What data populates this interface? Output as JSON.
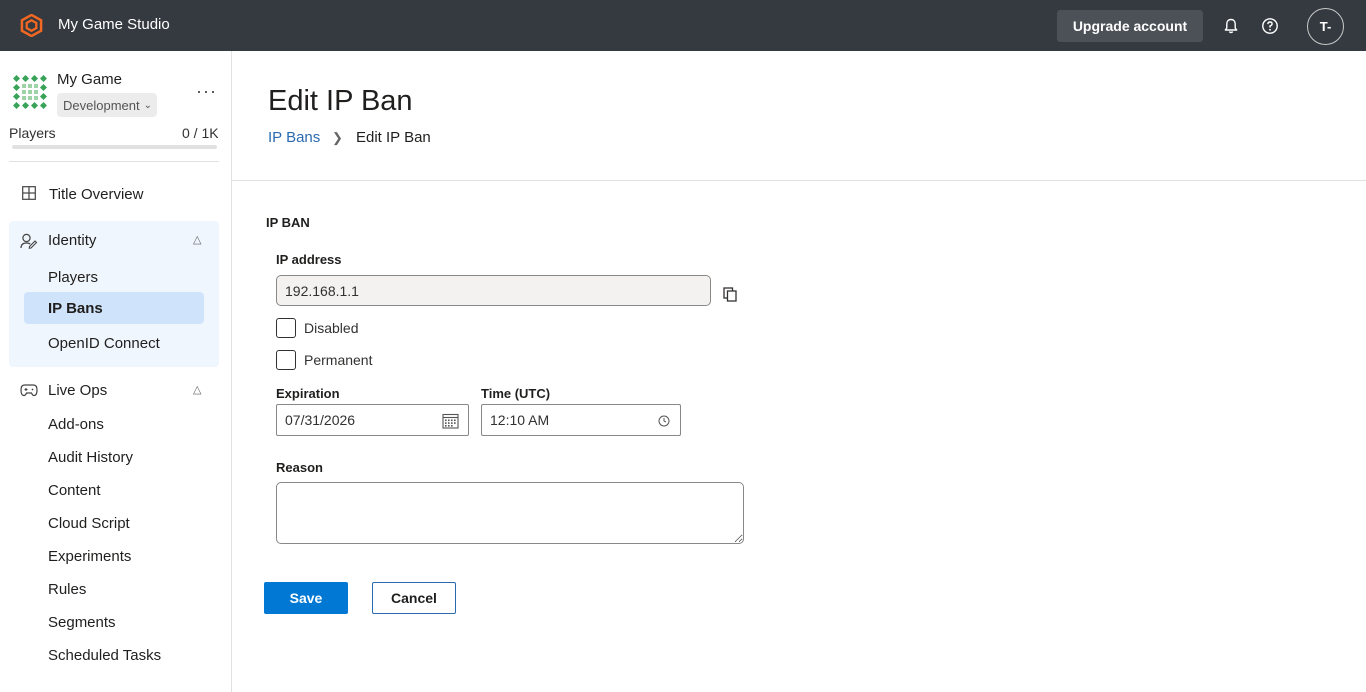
{
  "header": {
    "studio_name": "My Game Studio",
    "upgrade_label": "Upgrade account",
    "avatar_initials": "T-",
    "icons": [
      "studio-logo-icon",
      "bell-icon",
      "help-icon"
    ]
  },
  "sidebar": {
    "game_name": "My Game",
    "environment": "Development",
    "players_label": "Players",
    "players_count": "0 / 1K",
    "players_usage_fraction": 0,
    "title_overview": "Title Overview",
    "identity": {
      "label": "Identity",
      "items": [
        {
          "label": "Players",
          "active": false
        },
        {
          "label": "IP Bans",
          "active": true
        },
        {
          "label": "OpenID Connect",
          "active": false
        }
      ]
    },
    "live_ops": {
      "label": "Live Ops",
      "items": [
        "Add-ons",
        "Audit History",
        "Content",
        "Cloud Script",
        "Experiments",
        "Rules",
        "Segments",
        "Scheduled Tasks"
      ]
    }
  },
  "main": {
    "title": "Edit IP Ban",
    "breadcrumb": {
      "link": "IP Bans",
      "current": "Edit IP Ban"
    },
    "section_title": "IP BAN",
    "ip_label": "IP address",
    "ip_value": "192.168.1.1",
    "disabled_label": "Disabled",
    "disabled_checked": false,
    "permanent_label": "Permanent",
    "permanent_checked": false,
    "expiration_label": "Expiration",
    "expiration_value": "07/31/2026",
    "time_label": "Time (UTC)",
    "time_value": "12:10 AM",
    "reason_label": "Reason",
    "reason_value": "",
    "save_label": "Save",
    "cancel_label": "Cancel"
  },
  "colors": {
    "topbar": "#343a40",
    "accent": "#0078d4",
    "logo": "#f26722",
    "link": "#2a6bb0",
    "active_nav": "#cfe4fa"
  }
}
